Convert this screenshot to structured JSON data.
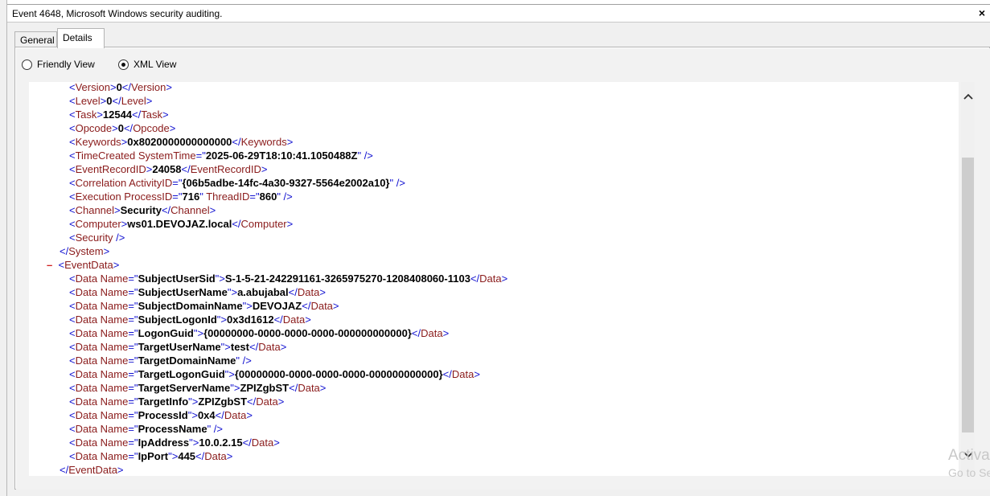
{
  "window": {
    "title": "Event 4648, Microsoft Windows security auditing.",
    "close_label": "×"
  },
  "tabs": [
    {
      "label": "General"
    },
    {
      "label": "Details"
    }
  ],
  "view_options": [
    {
      "label": "Friendly View",
      "selected": false
    },
    {
      "label": "XML View",
      "selected": true
    }
  ],
  "xml": {
    "system": {
      "version": "0",
      "level": "0",
      "task": "12544",
      "opcode": "0",
      "keywords": "0x8020000000000000",
      "time_created": "2025-06-29T18:10:41.1050488Z",
      "event_record_id": "24058",
      "activity_id": "{06b5adbe-14fc-4a30-9327-5564e2002a10}",
      "process_id": "716",
      "thread_id": "860",
      "channel": "Security",
      "computer": "ws01.DEVOJAZ.local"
    },
    "collapse_marker": "–",
    "event_data": [
      {
        "name": "SubjectUserSid",
        "value": "S-1-5-21-242291161-3265975270-1208408060-1103"
      },
      {
        "name": "SubjectUserName",
        "value": "a.abujabal"
      },
      {
        "name": "SubjectDomainName",
        "value": "DEVOJAZ"
      },
      {
        "name": "SubjectLogonId",
        "value": "0x3d1612"
      },
      {
        "name": "LogonGuid",
        "value": "{00000000-0000-0000-0000-000000000000}"
      },
      {
        "name": "TargetUserName",
        "value": "test"
      },
      {
        "name": "TargetDomainName",
        "value": ""
      },
      {
        "name": "TargetLogonGuid",
        "value": "{00000000-0000-0000-0000-000000000000}"
      },
      {
        "name": "TargetServerName",
        "value": "ZPIZgbST"
      },
      {
        "name": "TargetInfo",
        "value": "ZPIZgbST"
      },
      {
        "name": "ProcessId",
        "value": "0x4"
      },
      {
        "name": "ProcessName",
        "value": ""
      },
      {
        "name": "IpAddress",
        "value": "10.0.2.15"
      },
      {
        "name": "IpPort",
        "value": "445"
      }
    ]
  },
  "watermark": {
    "line1": "Activa",
    "line2": "Go to Se"
  },
  "icons": {
    "scroll_up": "chevron-up-icon",
    "scroll_down": "chevron-down-icon"
  }
}
